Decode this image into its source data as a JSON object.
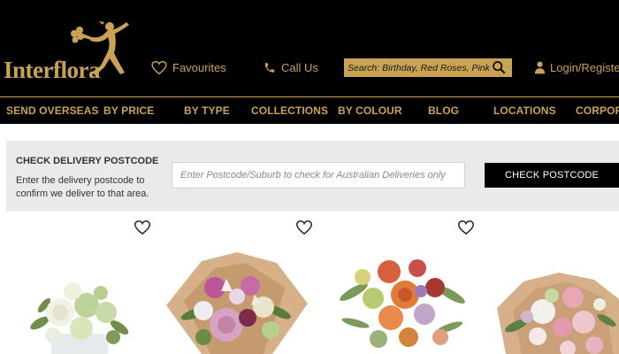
{
  "brand": {
    "name": "Interflora",
    "accent_color": "#c9a253",
    "header_bg": "#000000"
  },
  "header": {
    "favourites_label": "Favourites",
    "favourites_icon": "heart-outline-icon",
    "call_label": "Call Us",
    "call_icon": "phone-icon",
    "search_placeholder": "Search: Birthday, Red Roses, Pink Flowers",
    "search_icon": "search-icon",
    "login_label": "Login/Register",
    "login_icon": "user-icon"
  },
  "nav": {
    "items": [
      {
        "label": "SEND OVERSEAS"
      },
      {
        "label": "BY PRICE"
      },
      {
        "label": "BY TYPE"
      },
      {
        "label": "COLLECTIONS"
      },
      {
        "label": "BY COLOUR"
      },
      {
        "label": "BLOG"
      },
      {
        "label": "LOCATIONS"
      },
      {
        "label": "CORPORATE"
      }
    ]
  },
  "postcode": {
    "title": "CHECK DELIVERY POSTCODE",
    "description": "Enter the delivery postcode to confirm we deliver to that area.",
    "input_placeholder": "Enter Postcode/Suburb to check for Australian Deliveries only",
    "button_label": "CHECK POSTCODE"
  },
  "products": [
    {
      "image": "white-green-flowers-in-glass-vase",
      "favourite_icon": "heart-outline-icon"
    },
    {
      "image": "pink-purple-bouquet-in-kraft-paper",
      "favourite_icon": "heart-outline-icon"
    },
    {
      "image": "native-protea-bouquet",
      "favourite_icon": "heart-outline-icon"
    },
    {
      "image": "pastel-rose-bouquet-in-kraft-paper",
      "favourite_icon": "none"
    }
  ]
}
